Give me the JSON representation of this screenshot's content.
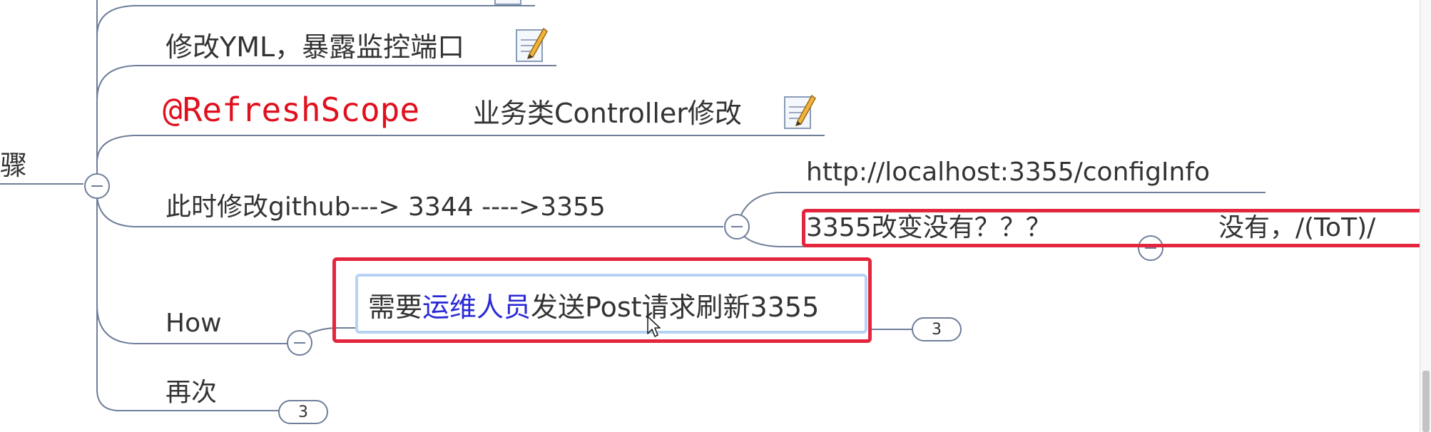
{
  "mindmap": {
    "parent_label": "骤",
    "branches": {
      "modify_yml": "修改YML，暴露监控端口",
      "refresh_scope_annotation": "@RefreshScope",
      "refresh_scope_rest": "业务类Controller修改",
      "modify_github": "此时修改github---> 3344 ---->3355",
      "how": "How",
      "again": "再次"
    },
    "children": {
      "config_url": "http://localhost:3355/configInfo",
      "changed_question": "3355改变没有？？？",
      "answer": "没有，/(ToT)/",
      "ops_prefix": "需要",
      "ops_highlight": "运维人员",
      "ops_suffix": "发送Post请求刷新3355"
    },
    "badges": {
      "how_count": "3",
      "again_count": "3"
    }
  },
  "colors": {
    "line": "#6f7e99",
    "annotation_red": "#e0101e",
    "link_blue": "#2a2ad6",
    "highlight_red": "#e3263e",
    "selection_blue": "#b6d3f6"
  }
}
